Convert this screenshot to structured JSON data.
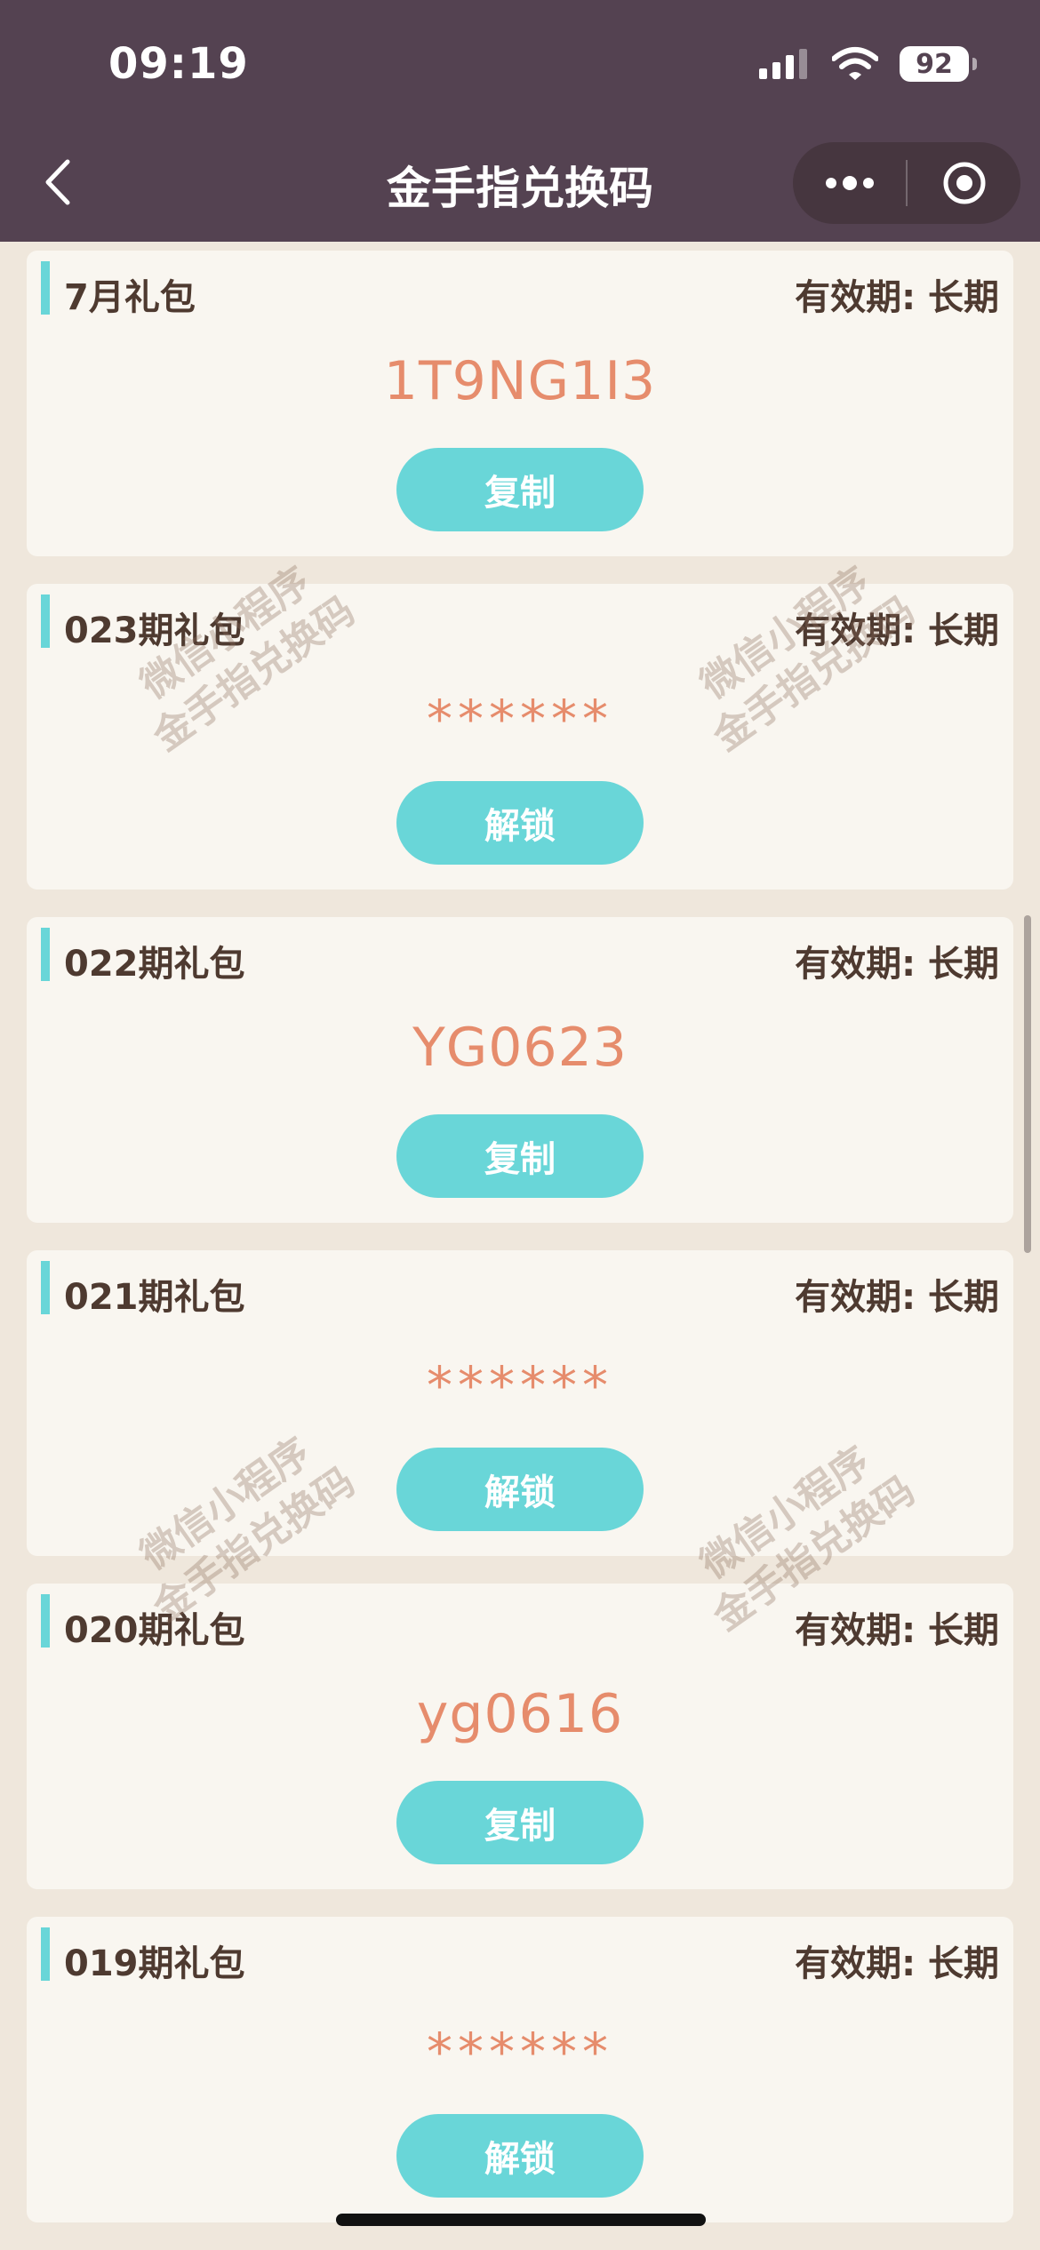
{
  "status_bar": {
    "time": "09:19",
    "battery": "92"
  },
  "nav": {
    "title": "金手指兑换码"
  },
  "cards": [
    {
      "title": "7月礼包",
      "validity": "有效期: 长期",
      "code": "1T9NG1I3",
      "button": "复制"
    },
    {
      "title": "023期礼包",
      "validity": "有效期: 长期",
      "code": "******",
      "button": "解锁"
    },
    {
      "title": "022期礼包",
      "validity": "有效期: 长期",
      "code": "YG0623",
      "button": "复制"
    },
    {
      "title": "021期礼包",
      "validity": "有效期: 长期",
      "code": "******",
      "button": "解锁"
    },
    {
      "title": "020期礼包",
      "validity": "有效期: 长期",
      "code": "yg0616",
      "button": "复制"
    },
    {
      "title": "019期礼包",
      "validity": "有效期: 长期",
      "code": "******",
      "button": "解锁"
    }
  ],
  "watermark": {
    "line1": "微信小程序",
    "line2": "金手指兑换码"
  },
  "colors": {
    "header_bg": "#544251",
    "page_bg": "#efe7dc",
    "card_bg": "#f9f6f0",
    "accent": "#69d6d8",
    "code": "#e68c6c",
    "title_text": "#4e3a30"
  }
}
